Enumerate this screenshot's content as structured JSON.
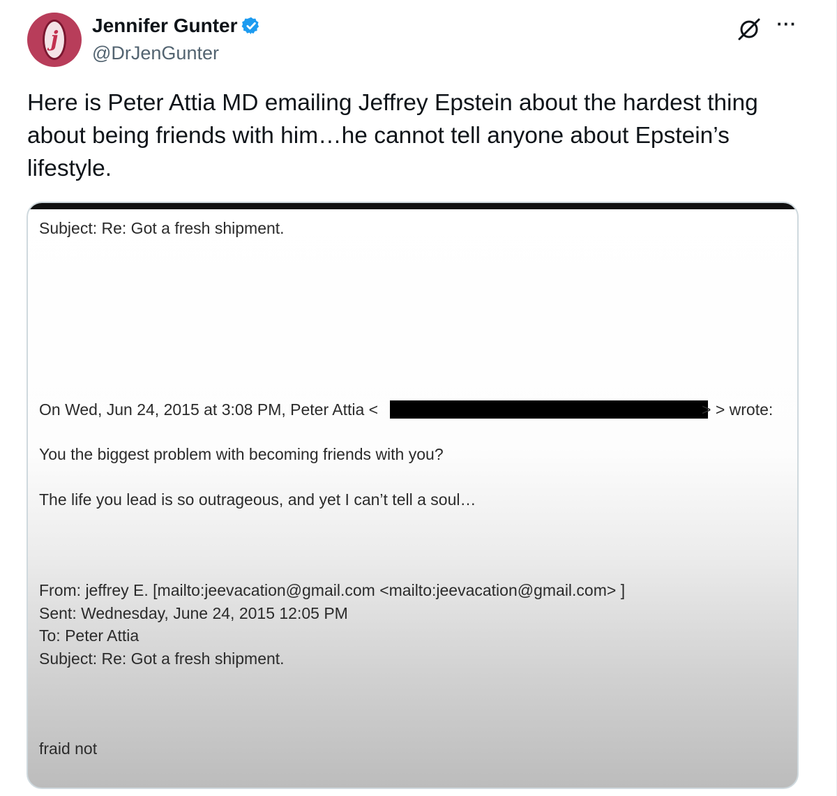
{
  "author": {
    "display_name": "Jennifer Gunter",
    "handle": "@DrJenGunter",
    "avatar_letter": "j",
    "verified_color": "#1d9bf0",
    "avatar_color": "#b83d5a"
  },
  "actions": {
    "grok_icon": "grok-icon",
    "more_label": "···"
  },
  "tweet": {
    "text": "Here is Peter Attia MD emailing Jeffrey Epstein about the hardest thing about being friends with him…he cannot tell anyone about Epstein’s lifestyle."
  },
  "email": {
    "subject_top": "Subject: Re: Got a fresh shipment.",
    "quote_header_prefix": "On Wed, Jun 24, 2015 at 3:08 PM, Peter Attia <",
    "quote_header_suffix": "> > wrote:",
    "line1": "You the biggest problem with becoming friends with you?",
    "line2": "The life you lead is so outrageous, and yet I can’t tell a soul…",
    "from": "From: jeffrey E. [mailto:jeevacation@gmail.com <mailto:jeevacation@gmail.com> ]",
    "sent": "Sent: Wednesday, June 24, 2015 12:05 PM",
    "to": "To: Peter Attia",
    "subject_bottom": "Subject: Re: Got a fresh shipment.",
    "body": "fraid not"
  }
}
